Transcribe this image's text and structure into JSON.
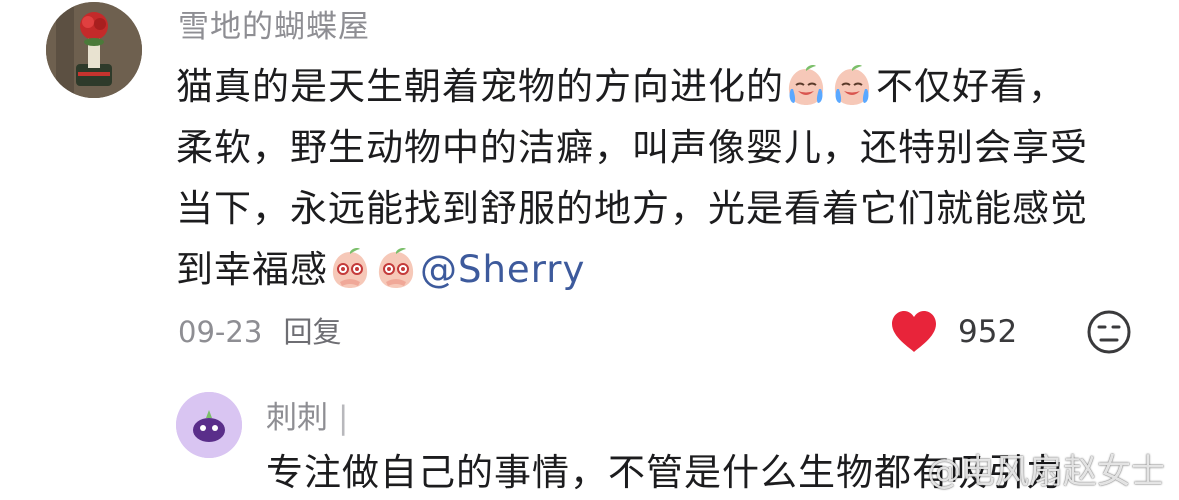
{
  "comment": {
    "username": "雪地的蝴蝶屋",
    "text_lines": [
      "猫真的是天生朝着宠物的方向进化的",
      "不仅好看，",
      "柔软，野生动物中的洁癖，叫声像婴儿，还特别会享受",
      "当下，永远能找到舒服的地方，光是看着它们就能感觉",
      "到幸福感",
      "@Sherry"
    ],
    "date": "09-23",
    "reply_label": "回复",
    "like_count": "952",
    "emoji_1": "crying-peach-emoji",
    "emoji_2": "pleading-peach-emoji"
  },
  "reply": {
    "username": "刺刺",
    "separator": "|",
    "text": "专注做自己的事情，不管是什么生物都有吸引力"
  },
  "watermark": "@电风扇赵女士",
  "colors": {
    "like_heart": "#e8243a",
    "mention": "#3d5a9c",
    "muted_text": "#8e8e93"
  }
}
